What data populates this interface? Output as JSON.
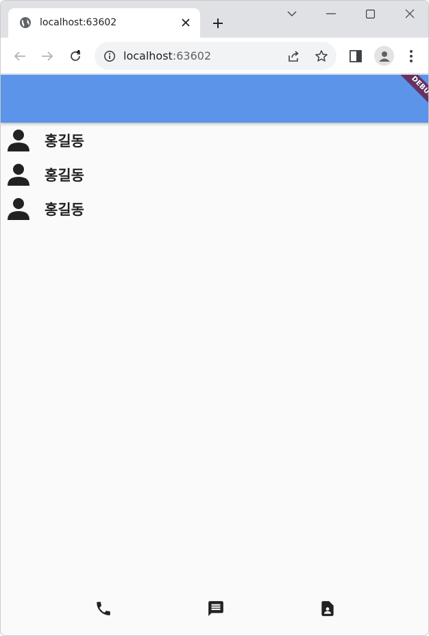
{
  "browser": {
    "tab_title": "localhost:63602",
    "url_host": "localhost",
    "url_port": ":63602"
  },
  "app": {
    "appbar_color": "#5b94e9",
    "debug_label": "DEBUG",
    "contacts": [
      {
        "name": "홍길동",
        "icon": "person-icon"
      },
      {
        "name": "홍길동",
        "icon": "person-icon"
      },
      {
        "name": "홍길동",
        "icon": "person-icon"
      }
    ],
    "bottom_nav": [
      {
        "icon": "phone-icon"
      },
      {
        "icon": "message-icon"
      },
      {
        "icon": "contact-card-icon"
      }
    ]
  }
}
